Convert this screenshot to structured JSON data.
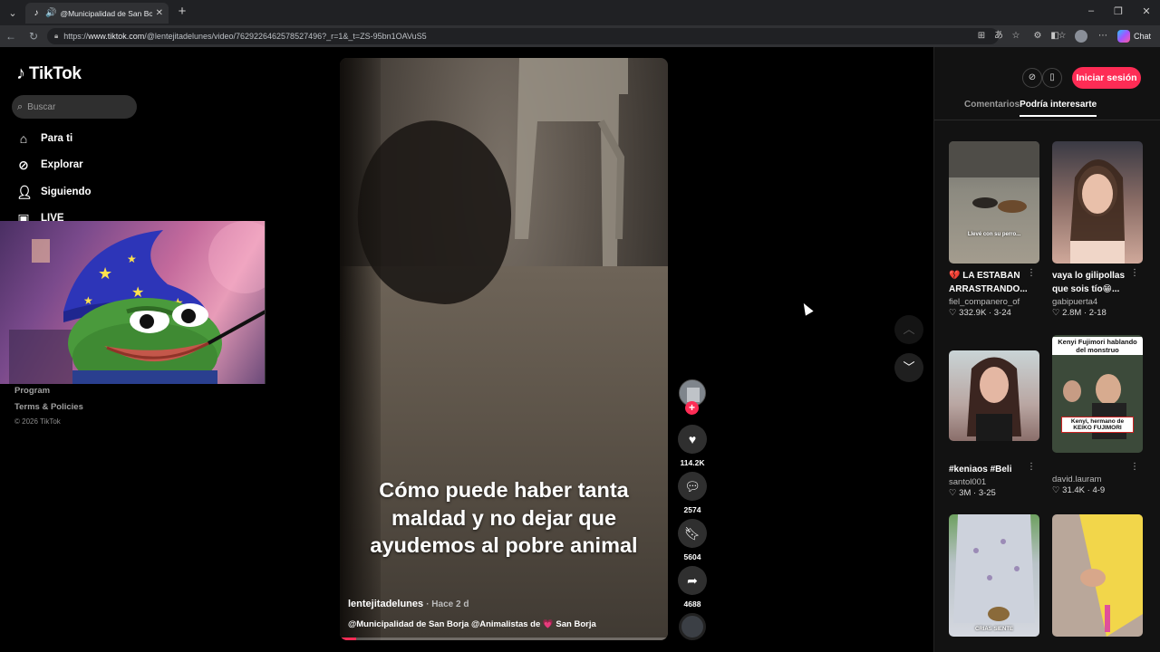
{
  "browser": {
    "tab_title": "@Municipalidad de San Borja",
    "url_prefix": "https://",
    "url_host": "www.tiktok.com",
    "url_path": "/@lentejitadelunes/video/7629226462578527496?_r=1&_t=ZS-95bn1OAVuS5",
    "copilot_label": "Chat"
  },
  "sidebar": {
    "logo": "TikTok",
    "search_placeholder": "Buscar",
    "nav": [
      {
        "label": "Para ti",
        "icon": "home-icon"
      },
      {
        "label": "Explorar",
        "icon": "compass-icon"
      },
      {
        "label": "Siguiendo",
        "icon": "following-icon"
      },
      {
        "label": "LIVE",
        "icon": "live-icon"
      }
    ],
    "footer_links": [
      "Program",
      "Terms & Policies"
    ],
    "copyright": "© 2026 TikTok"
  },
  "video": {
    "caption": "Cómo puede haber tanta maldad y no dejar que ayudemos al pobre animal",
    "author": "lentejitadelunes",
    "posted": "· Hace 2 d",
    "description": "@Municipalidad de San Borja @Animalistas de",
    "description_tail": "San Borja",
    "progress": 0.05
  },
  "actions": {
    "likes": "114.2K",
    "comments": "2574",
    "saves": "5604",
    "shares": "4688"
  },
  "right_panel": {
    "login_label": "Iniciar sesión",
    "tab_comments": "Comentarios",
    "tab_suggested": "Podría interesarte",
    "cards": [
      {
        "title": "💔 LA ESTABAN ARRASTRANDO...",
        "user": "fiel_companero_of",
        "likes": "332.9K",
        "date": "3-24",
        "overlay": "Llevé con su perro... "
      },
      {
        "title": "vaya lo gilipollas que sois tío😁...",
        "user": "gabipuerta4",
        "likes": "2.8M",
        "date": "2-18",
        "overlay": ""
      },
      {
        "title": "#keniaos #Beli",
        "user": "santol001",
        "likes": "3M",
        "date": "3-25",
        "overlay": ""
      },
      {
        "title": "",
        "user": "david.lauram",
        "likes": "31.4K",
        "date": "4-9",
        "overlay_top": "Kenyi Fujimori hablando del monstruo",
        "overlay_bottom": "Kenyi, hermano de KEIKO FUJIMORI"
      },
      {
        "title": "",
        "user": "",
        "likes": "",
        "date": "",
        "overlay": "CRIAS SIENTE"
      },
      {
        "title": "",
        "user": "",
        "likes": "",
        "date": "",
        "overlay": ""
      }
    ]
  },
  "colors": {
    "brand": "#fe2c55",
    "background": "#000000",
    "panel": "#121212"
  }
}
